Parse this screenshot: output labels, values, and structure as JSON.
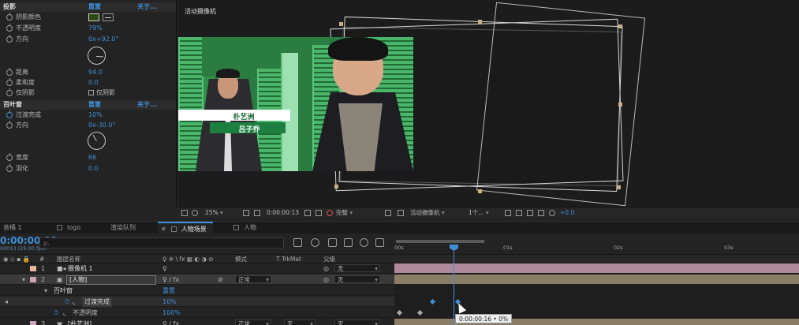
{
  "effects": {
    "shadow": {
      "title": "投影",
      "reset": "重置",
      "about": "关于...",
      "rows": [
        {
          "label": "阴影颜色",
          "value": ""
        },
        {
          "label": "不透明度",
          "value": "79",
          "unit": "%"
        },
        {
          "label": "方向",
          "value": "0x+92.0°"
        },
        {
          "label": "距离",
          "value": "94.0"
        },
        {
          "label": "柔和度",
          "value": "0.0"
        },
        {
          "label": "仅阴影",
          "value": "仅阴影"
        }
      ]
    },
    "blinds": {
      "title": "百叶窗",
      "reset": "重置",
      "about": "关于...",
      "rows": [
        {
          "label": "过渡完成",
          "value": "10",
          "unit": "%"
        },
        {
          "label": "方向",
          "value": "0x-30.0°"
        },
        {
          "label": "宽度",
          "value": "66"
        },
        {
          "label": "羽化",
          "value": "0.0"
        }
      ]
    }
  },
  "viewer": {
    "title": "活动摄像机",
    "name_tag_1": "朴艺洲",
    "name_tag_2": "吕子乔"
  },
  "viewer_toolbar": {
    "zoom": "25%",
    "timecode": "0:00:00:13",
    "quality": "完整",
    "camera": "活动摄像机",
    "views": "1个...",
    "exposure": "+0.0"
  },
  "tabs": [
    {
      "label": "音桶 1",
      "active": false
    },
    {
      "label": "logo",
      "active": false
    },
    {
      "label": "渲染队列",
      "active": false
    },
    {
      "label": "人物场景",
      "active": true
    },
    {
      "label": "人物",
      "active": false
    }
  ],
  "timeline": {
    "timecode": "0:00:00:13",
    "fps": "00013 (25.00 fps)",
    "search_placeholder": "ρ.",
    "ruler": [
      "00s",
      "01s",
      "02s",
      "03s"
    ],
    "progress_fraction": 0.33
  },
  "columns": {
    "layer_name": "图层名称",
    "switches": "♀ ✲ \\ fx ▦ ◐ ◑ ⊘",
    "mode": "模式",
    "trkmat": "T  TrkMat",
    "parent": "父级",
    "hash": "#"
  },
  "layers": [
    {
      "num": "1",
      "name": "摄像机 1",
      "switch": "♀",
      "mode": "",
      "trk": "",
      "parent": "无",
      "color": "#e8b89c"
    },
    {
      "num": "2",
      "name": "[人物]",
      "switch": "♀  / fx",
      "mode": "正常",
      "trk": "",
      "parent": "无",
      "color": "#c8a8b8"
    },
    {
      "effect_group": "百叶窗",
      "reset": "重置"
    },
    {
      "prop": "过渡完成",
      "value": "10%"
    },
    {
      "prop": "不透明度",
      "value": "100%"
    },
    {
      "num": "3",
      "name": "[朴艺洲]",
      "switch": "♀  / fx",
      "mode": "正常",
      "trk": "无",
      "parent": "无",
      "color": "#c8a8b8"
    }
  ],
  "tooltip": "0:00:00:16 • 0%",
  "colors": {
    "accent": "#3f8fd8",
    "layer1_bar": "#b08a9a",
    "layer2_bar": "#8a7e66"
  }
}
